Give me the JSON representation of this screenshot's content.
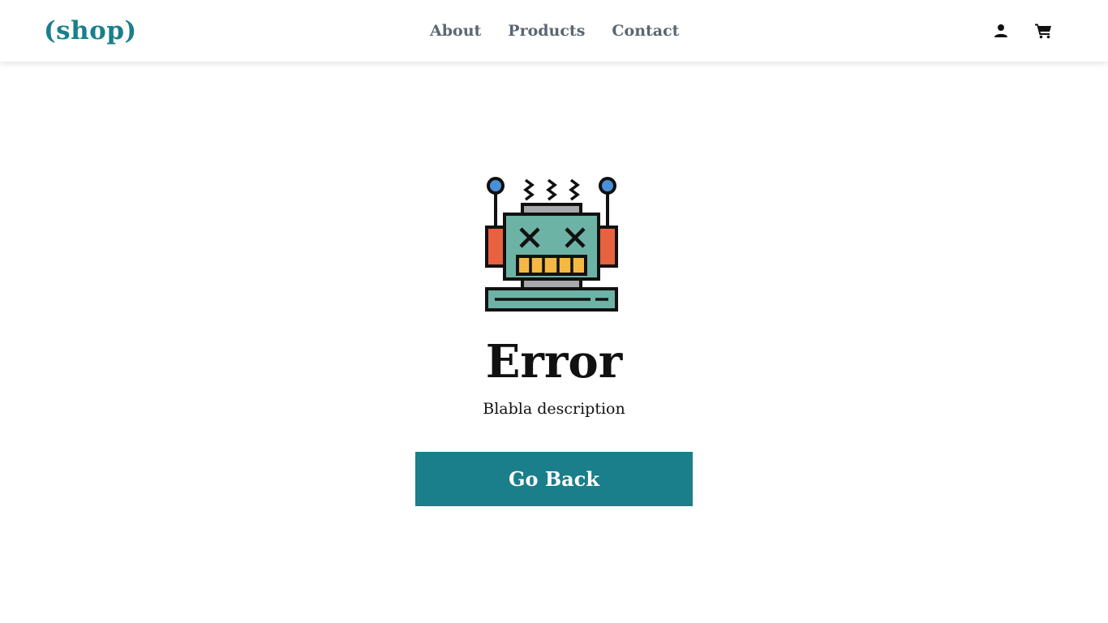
{
  "header": {
    "logo": "(shop)",
    "nav": [
      {
        "label": "About"
      },
      {
        "label": "Products"
      },
      {
        "label": "Contact"
      }
    ],
    "icons": {
      "user": "user-icon",
      "cart": "cart-icon"
    }
  },
  "error": {
    "illustration": "broken-robot-icon",
    "title": "Error",
    "description": "Blabla description",
    "button_label": "Go Back"
  },
  "colors": {
    "brand": "#1a7f8a",
    "nav_text": "#5b6672",
    "robot_face": "#6db3a5",
    "robot_ears": "#e8623f",
    "robot_teeth": "#f5b843",
    "robot_antenna_tip": "#4a90d9",
    "robot_grey": "#a7a9ac"
  }
}
